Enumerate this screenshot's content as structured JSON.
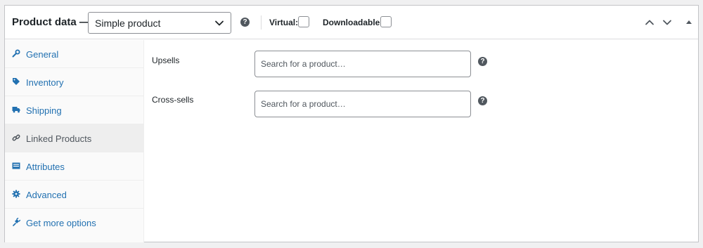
{
  "header": {
    "title": "Product data —",
    "product_type": {
      "selected": "Simple product"
    },
    "virtual_label": "Virtual:",
    "downloadable_label": "Downloadable:",
    "help_glyph": "?"
  },
  "sidebar": {
    "items": [
      {
        "label": "General",
        "icon": "wrench-icon"
      },
      {
        "label": "Inventory",
        "icon": "tag-icon"
      },
      {
        "label": "Shipping",
        "icon": "truck-icon"
      },
      {
        "label": "Linked Products",
        "icon": "link-icon",
        "active": true
      },
      {
        "label": "Attributes",
        "icon": "list-icon"
      },
      {
        "label": "Advanced",
        "icon": "gear-icon"
      },
      {
        "label": "Get more options",
        "icon": "plugin-icon"
      }
    ]
  },
  "main": {
    "upsells": {
      "label": "Upsells",
      "placeholder": "Search for a product…"
    },
    "cross_sells": {
      "label": "Cross-sells",
      "placeholder": "Search for a product…"
    }
  },
  "colors": {
    "link": "#2271b1",
    "active_tab_bg": "#eeeeee",
    "icon": "#2271b1"
  }
}
